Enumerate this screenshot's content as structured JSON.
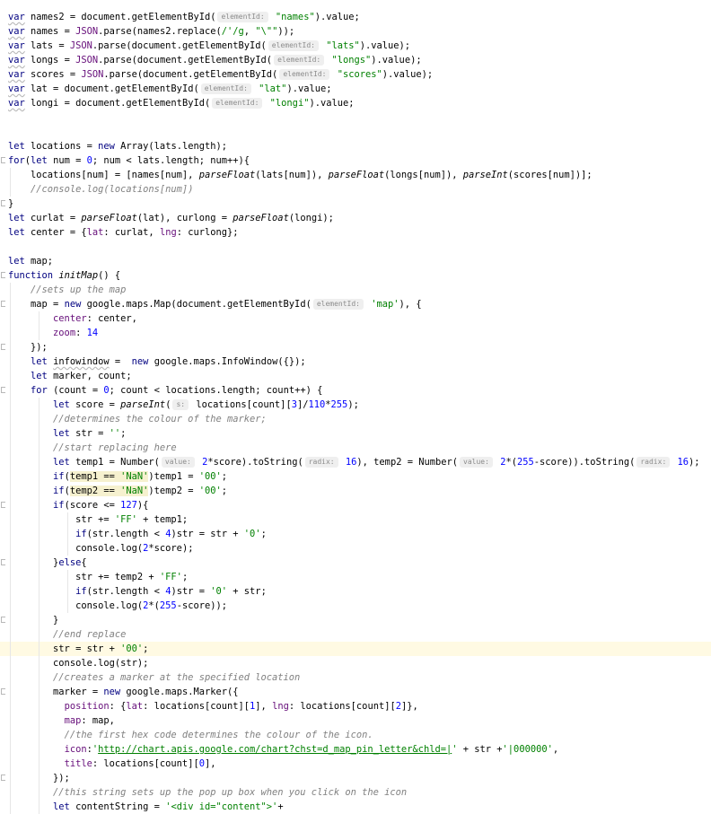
{
  "editor": {
    "current_line": 44,
    "lines": [
      {
        "t": [
          {
            "v": "var",
            "c": "kw wavy"
          },
          {
            "v": " names2 = document.getElementById("
          },
          {
            "v": "elementId:",
            "c": "hint"
          },
          {
            "v": " \"names\"",
            "c": "str"
          },
          {
            "v": ").value;"
          }
        ]
      },
      {
        "t": [
          {
            "v": "var",
            "c": "kw wavy"
          },
          {
            "v": " names = "
          },
          {
            "v": "JSON",
            "c": "prop"
          },
          {
            "v": ".parse(names2.replace("
          },
          {
            "v": "/'/g",
            "c": "str"
          },
          {
            "v": ", "
          },
          {
            "v": "\"\\\"\"",
            "c": "str"
          },
          {
            "v": "));"
          }
        ]
      },
      {
        "t": [
          {
            "v": "var",
            "c": "kw wavy"
          },
          {
            "v": " lats = "
          },
          {
            "v": "JSON",
            "c": "prop"
          },
          {
            "v": ".parse(document.getElementById("
          },
          {
            "v": "elementId:",
            "c": "hint"
          },
          {
            "v": " \"lats\"",
            "c": "str"
          },
          {
            "v": ").value);"
          }
        ]
      },
      {
        "t": [
          {
            "v": "var",
            "c": "kw wavy"
          },
          {
            "v": " longs = "
          },
          {
            "v": "JSON",
            "c": "prop"
          },
          {
            "v": ".parse(document.getElementById("
          },
          {
            "v": "elementId:",
            "c": "hint"
          },
          {
            "v": " \"longs\"",
            "c": "str"
          },
          {
            "v": ").value);"
          }
        ]
      },
      {
        "t": [
          {
            "v": "var",
            "c": "kw wavy"
          },
          {
            "v": " scores = "
          },
          {
            "v": "JSON",
            "c": "prop"
          },
          {
            "v": ".parse(document.getElementById("
          },
          {
            "v": "elementId:",
            "c": "hint"
          },
          {
            "v": " \"scores\"",
            "c": "str"
          },
          {
            "v": ").value);"
          }
        ]
      },
      {
        "t": [
          {
            "v": "var",
            "c": "kw wavy"
          },
          {
            "v": " lat = document.getElementById("
          },
          {
            "v": "elementId:",
            "c": "hint"
          },
          {
            "v": " \"lat\"",
            "c": "str"
          },
          {
            "v": ").value;"
          }
        ]
      },
      {
        "t": [
          {
            "v": "var",
            "c": "kw wavy"
          },
          {
            "v": " longi = document.getElementById("
          },
          {
            "v": "elementId:",
            "c": "hint"
          },
          {
            "v": " \"longi\"",
            "c": "str"
          },
          {
            "v": ").value;"
          }
        ]
      },
      {
        "t": []
      },
      {
        "t": []
      },
      {
        "t": [
          {
            "v": "let",
            "c": "kw"
          },
          {
            "v": " locations = "
          },
          {
            "v": "new",
            "c": "kw"
          },
          {
            "v": " Array(lats.length);"
          }
        ]
      },
      {
        "fold": true,
        "t": [
          {
            "v": "for",
            "c": "kw"
          },
          {
            "v": "("
          },
          {
            "v": "let",
            "c": "kw"
          },
          {
            "v": " num = "
          },
          {
            "v": "0",
            "c": "num"
          },
          {
            "v": "; num < lats.length; num++){"
          }
        ]
      },
      {
        "t": [
          {
            "v": "    locations[num] = [names[num], "
          },
          {
            "v": "parseFloat",
            "c": "fn"
          },
          {
            "v": "(lats[num]), "
          },
          {
            "v": "parseFloat",
            "c": "fn"
          },
          {
            "v": "(longs[num]), "
          },
          {
            "v": "parseInt",
            "c": "fn"
          },
          {
            "v": "(scores[num])];"
          }
        ]
      },
      {
        "t": [
          {
            "v": "    "
          },
          {
            "v": "//console.log(locations[num])",
            "c": "cm"
          }
        ]
      },
      {
        "fold": true,
        "t": [
          {
            "v": "}"
          }
        ]
      },
      {
        "t": [
          {
            "v": "let",
            "c": "kw"
          },
          {
            "v": " curlat = "
          },
          {
            "v": "parseFloat",
            "c": "fn"
          },
          {
            "v": "(lat), curlong = "
          },
          {
            "v": "parseFloat",
            "c": "fn"
          },
          {
            "v": "(longi);"
          }
        ]
      },
      {
        "t": [
          {
            "v": "let",
            "c": "kw"
          },
          {
            "v": " center = {"
          },
          {
            "v": "lat",
            "c": "prop"
          },
          {
            "v": ": curlat, "
          },
          {
            "v": "lng",
            "c": "prop"
          },
          {
            "v": ": curlong};"
          }
        ]
      },
      {
        "t": []
      },
      {
        "t": [
          {
            "v": "let",
            "c": "kw"
          },
          {
            "v": " map;"
          }
        ]
      },
      {
        "fold": true,
        "t": [
          {
            "v": "function",
            "c": "kw"
          },
          {
            "v": " "
          },
          {
            "v": "initMap",
            "c": "fn"
          },
          {
            "v": "() {"
          }
        ]
      },
      {
        "t": [
          {
            "v": "    "
          },
          {
            "v": "//sets up the map",
            "c": "cm"
          }
        ]
      },
      {
        "fold": true,
        "t": [
          {
            "v": "    map = "
          },
          {
            "v": "new",
            "c": "kw"
          },
          {
            "v": " google.maps.Map(document.getElementById("
          },
          {
            "v": "elementId:",
            "c": "hint"
          },
          {
            "v": " 'map'",
            "c": "str"
          },
          {
            "v": "), {"
          }
        ]
      },
      {
        "t": [
          {
            "v": "        "
          },
          {
            "v": "center",
            "c": "prop"
          },
          {
            "v": ": center,"
          }
        ]
      },
      {
        "t": [
          {
            "v": "        "
          },
          {
            "v": "zoom",
            "c": "prop"
          },
          {
            "v": ": "
          },
          {
            "v": "14",
            "c": "num"
          }
        ]
      },
      {
        "fold": true,
        "t": [
          {
            "v": "    });"
          }
        ]
      },
      {
        "t": [
          {
            "v": "    "
          },
          {
            "v": "let",
            "c": "kw"
          },
          {
            "v": " "
          },
          {
            "v": "infowindow",
            "c": "wavy"
          },
          {
            "v": " =  "
          },
          {
            "v": "new",
            "c": "kw"
          },
          {
            "v": " google.maps.InfoWindow({});"
          }
        ]
      },
      {
        "t": [
          {
            "v": "    "
          },
          {
            "v": "let",
            "c": "kw"
          },
          {
            "v": " marker, count;"
          }
        ]
      },
      {
        "fold": true,
        "t": [
          {
            "v": "    "
          },
          {
            "v": "for",
            "c": "kw"
          },
          {
            "v": " (count = "
          },
          {
            "v": "0",
            "c": "num"
          },
          {
            "v": "; count < locations.length; count++) {"
          }
        ]
      },
      {
        "t": [
          {
            "v": "        "
          },
          {
            "v": "let",
            "c": "kw"
          },
          {
            "v": " score = "
          },
          {
            "v": "parseInt",
            "c": "fn"
          },
          {
            "v": "("
          },
          {
            "v": "s:",
            "c": "hint"
          },
          {
            "v": " locations[count]["
          },
          {
            "v": "3",
            "c": "num"
          },
          {
            "v": "]/"
          },
          {
            "v": "110",
            "c": "num"
          },
          {
            "v": "*"
          },
          {
            "v": "255",
            "c": "num"
          },
          {
            "v": ");"
          }
        ]
      },
      {
        "t": [
          {
            "v": "        "
          },
          {
            "v": "//determines the colour of the marker;",
            "c": "cm"
          }
        ]
      },
      {
        "t": [
          {
            "v": "        "
          },
          {
            "v": "let",
            "c": "kw"
          },
          {
            "v": " str = "
          },
          {
            "v": "''",
            "c": "str"
          },
          {
            "v": ";"
          }
        ]
      },
      {
        "t": [
          {
            "v": "        "
          },
          {
            "v": "//start replacing here",
            "c": "cm"
          }
        ]
      },
      {
        "t": [
          {
            "v": "        "
          },
          {
            "v": "let",
            "c": "kw"
          },
          {
            "v": " temp1 = Number("
          },
          {
            "v": "value:",
            "c": "hint"
          },
          {
            "v": " "
          },
          {
            "v": "2",
            "c": "num"
          },
          {
            "v": "*score).toString("
          },
          {
            "v": "radix:",
            "c": "hint"
          },
          {
            "v": " "
          },
          {
            "v": "16",
            "c": "num"
          },
          {
            "v": "), temp2 = Number("
          },
          {
            "v": "value:",
            "c": "hint"
          },
          {
            "v": " "
          },
          {
            "v": "2",
            "c": "num"
          },
          {
            "v": "*("
          },
          {
            "v": "255",
            "c": "num"
          },
          {
            "v": "-score)).toString("
          },
          {
            "v": "radix:",
            "c": "hint"
          },
          {
            "v": " "
          },
          {
            "v": "16",
            "c": "num"
          },
          {
            "v": ");"
          }
        ]
      },
      {
        "t": [
          {
            "v": "        "
          },
          {
            "v": "if",
            "c": "kw"
          },
          {
            "v": "("
          },
          {
            "v": "temp1 == ",
            "c": "hl"
          },
          {
            "v": "'NaN'",
            "c": "str hl"
          },
          {
            "v": ")temp1 = "
          },
          {
            "v": "'00'",
            "c": "str"
          },
          {
            "v": ";"
          }
        ]
      },
      {
        "t": [
          {
            "v": "        "
          },
          {
            "v": "if",
            "c": "kw"
          },
          {
            "v": "("
          },
          {
            "v": "temp2 == ",
            "c": "hl"
          },
          {
            "v": "'NaN'",
            "c": "str hl"
          },
          {
            "v": ")temp2 = "
          },
          {
            "v": "'00'",
            "c": "str"
          },
          {
            "v": ";"
          }
        ]
      },
      {
        "fold": true,
        "t": [
          {
            "v": "        "
          },
          {
            "v": "if",
            "c": "kw"
          },
          {
            "v": "(score <= "
          },
          {
            "v": "127",
            "c": "num"
          },
          {
            "v": "){"
          }
        ]
      },
      {
        "t": [
          {
            "v": "            str += "
          },
          {
            "v": "'FF'",
            "c": "str"
          },
          {
            "v": " + temp1;"
          }
        ]
      },
      {
        "t": [
          {
            "v": "            "
          },
          {
            "v": "if",
            "c": "kw"
          },
          {
            "v": "(str.length < "
          },
          {
            "v": "4",
            "c": "num"
          },
          {
            "v": ")str = str + "
          },
          {
            "v": "'0'",
            "c": "str"
          },
          {
            "v": ";"
          }
        ]
      },
      {
        "t": [
          {
            "v": "            console.log("
          },
          {
            "v": "2",
            "c": "num"
          },
          {
            "v": "*score);"
          }
        ]
      },
      {
        "fold": true,
        "t": [
          {
            "v": "        }"
          },
          {
            "v": "else",
            "c": "kw"
          },
          {
            "v": "{"
          }
        ]
      },
      {
        "t": [
          {
            "v": "            str += temp2 + "
          },
          {
            "v": "'FF'",
            "c": "str"
          },
          {
            "v": ";"
          }
        ]
      },
      {
        "t": [
          {
            "v": "            "
          },
          {
            "v": "if",
            "c": "kw"
          },
          {
            "v": "(str.length < "
          },
          {
            "v": "4",
            "c": "num"
          },
          {
            "v": ")str = "
          },
          {
            "v": "'0'",
            "c": "str"
          },
          {
            "v": " + str;"
          }
        ]
      },
      {
        "t": [
          {
            "v": "            console.log("
          },
          {
            "v": "2",
            "c": "num"
          },
          {
            "v": "*("
          },
          {
            "v": "255",
            "c": "num"
          },
          {
            "v": "-score));"
          }
        ]
      },
      {
        "fold": true,
        "t": [
          {
            "v": "        }"
          }
        ]
      },
      {
        "t": [
          {
            "v": "        "
          },
          {
            "v": "//end replace",
            "c": "cm"
          }
        ]
      },
      {
        "t": [
          {
            "v": "        str = str + "
          },
          {
            "v": "'00'",
            "c": "str"
          },
          {
            "v": ";"
          }
        ]
      },
      {
        "t": [
          {
            "v": "        console.log(str);"
          }
        ]
      },
      {
        "t": [
          {
            "v": "        "
          },
          {
            "v": "//creates a marker at the specified location",
            "c": "cm"
          }
        ]
      },
      {
        "fold": true,
        "t": [
          {
            "v": "        marker = "
          },
          {
            "v": "new",
            "c": "kw"
          },
          {
            "v": " google.maps.Marker({"
          }
        ]
      },
      {
        "t": [
          {
            "v": "          "
          },
          {
            "v": "position",
            "c": "prop"
          },
          {
            "v": ": {"
          },
          {
            "v": "lat",
            "c": "prop"
          },
          {
            "v": ": locations[count]["
          },
          {
            "v": "1",
            "c": "num"
          },
          {
            "v": "], "
          },
          {
            "v": "lng",
            "c": "prop"
          },
          {
            "v": ": locations[count]["
          },
          {
            "v": "2",
            "c": "num"
          },
          {
            "v": "]},"
          }
        ]
      },
      {
        "t": [
          {
            "v": "          "
          },
          {
            "v": "map",
            "c": "prop"
          },
          {
            "v": ": map,"
          }
        ]
      },
      {
        "t": [
          {
            "v": "          "
          },
          {
            "v": "//the first hex code determines the colour of the icon.",
            "c": "cm"
          }
        ]
      },
      {
        "t": [
          {
            "v": "          "
          },
          {
            "v": "icon",
            "c": "prop"
          },
          {
            "v": ":"
          },
          {
            "v": "'",
            "c": "str"
          },
          {
            "v": "http://chart.apis.google.com/chart?chst=d_map_pin_letter&chld=|",
            "c": "link"
          },
          {
            "v": "'",
            "c": "str"
          },
          {
            "v": " + str +"
          },
          {
            "v": "'|000000'",
            "c": "str"
          },
          {
            "v": ","
          }
        ]
      },
      {
        "t": [
          {
            "v": "          "
          },
          {
            "v": "title",
            "c": "prop"
          },
          {
            "v": ": locations[count]["
          },
          {
            "v": "0",
            "c": "num"
          },
          {
            "v": "],"
          }
        ]
      },
      {
        "fold": true,
        "t": [
          {
            "v": "        });"
          }
        ]
      },
      {
        "t": [
          {
            "v": "        "
          },
          {
            "v": "//this string sets up the pop up box when you click on the icon",
            "c": "cm"
          }
        ]
      },
      {
        "t": [
          {
            "v": "        "
          },
          {
            "v": "let",
            "c": "kw"
          },
          {
            "v": " contentString = "
          },
          {
            "v": "'<div id=\"content\">'",
            "c": "str"
          },
          {
            "v": "+"
          }
        ]
      }
    ]
  }
}
